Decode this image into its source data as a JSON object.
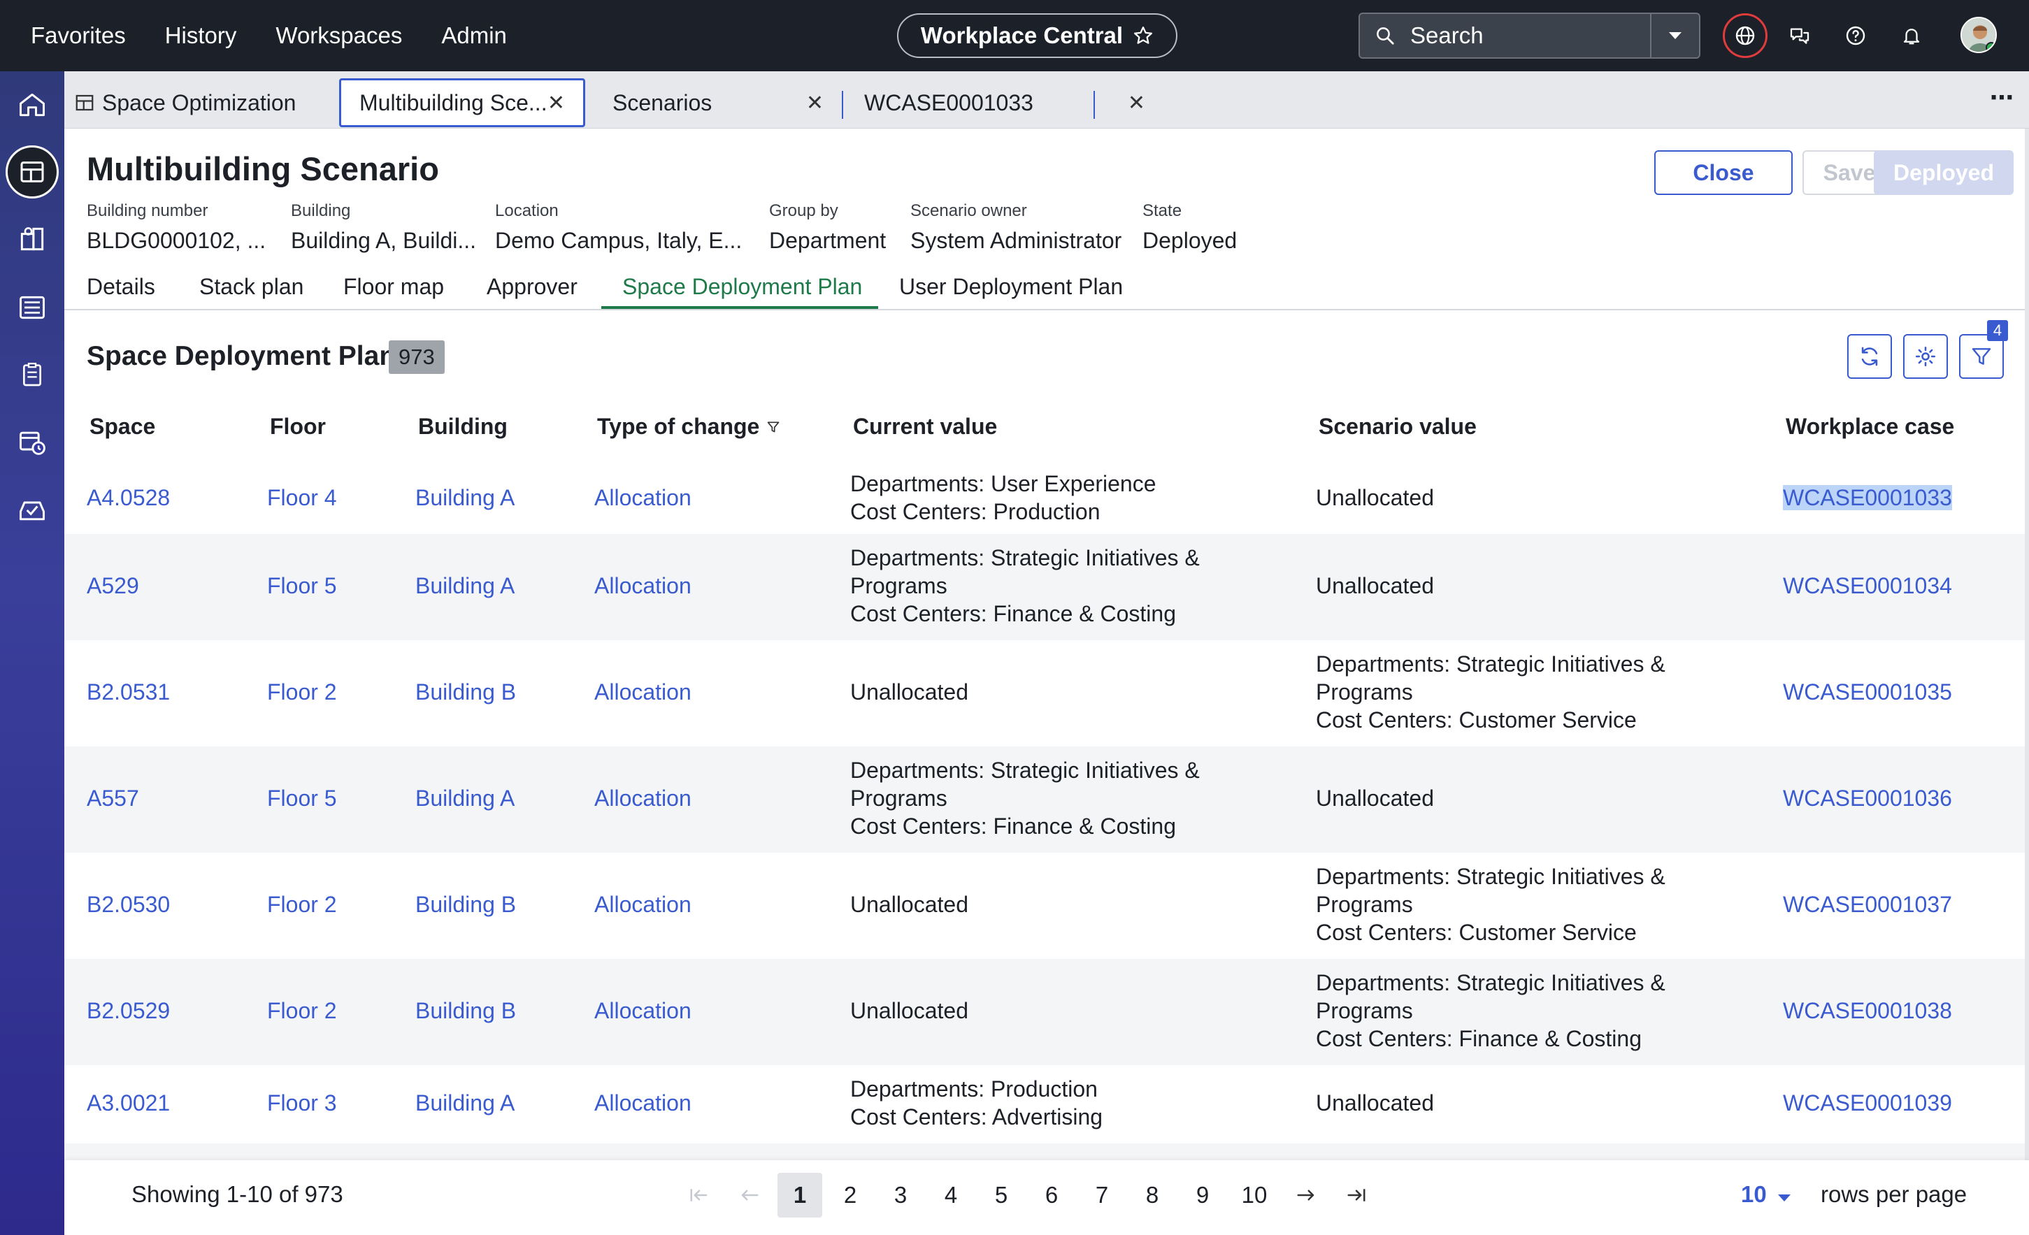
{
  "topbar": {
    "nav": [
      "Favorites",
      "History",
      "Workspaces",
      "Admin"
    ],
    "app_title": "Workplace Central",
    "search_placeholder": "Search"
  },
  "window_tabs": [
    {
      "label": "Space Optimization"
    },
    {
      "label": "Multibuilding Sce..."
    },
    {
      "label": "Scenarios"
    },
    {
      "label": "WCASE0001033"
    }
  ],
  "header": {
    "title": "Multibuilding Scenario",
    "close_label": "Close",
    "save_label": "Save",
    "deployed_label": "Deployed",
    "meta": [
      {
        "label": "Building number",
        "value": "BLDG0000102, ..."
      },
      {
        "label": "Building",
        "value": "Building A, Buildi..."
      },
      {
        "label": "Location",
        "value": "Demo Campus, Italy, E..."
      },
      {
        "label": "Group by",
        "value": "Department"
      },
      {
        "label": "Scenario owner",
        "value": "System Administrator"
      },
      {
        "label": "State",
        "value": "Deployed"
      }
    ]
  },
  "record_tabs": [
    "Details",
    "Stack plan",
    "Floor map",
    "Approver",
    "Space Deployment Plan",
    "User Deployment Plan"
  ],
  "section": {
    "title": "Space Deployment Plan",
    "count": "973",
    "filter_badge": "4"
  },
  "table": {
    "headers": [
      "Space",
      "Floor",
      "Building",
      "Type of change",
      "Current value",
      "Scenario value",
      "Workplace case"
    ],
    "rows": [
      {
        "space": "A4.0528",
        "floor": "Floor 4",
        "building": "Building A",
        "type": "Allocation",
        "current": [
          "Departments: User Experience",
          "Cost Centers: Production"
        ],
        "scenario": [
          "Unallocated"
        ],
        "case": "WCASE0001033"
      },
      {
        "space": "A529",
        "floor": "Floor 5",
        "building": "Building A",
        "type": "Allocation",
        "current": [
          "Departments: Strategic Initiatives &",
          "Programs",
          "Cost Centers: Finance & Costing"
        ],
        "scenario": [
          "Unallocated"
        ],
        "case": "WCASE0001034"
      },
      {
        "space": "B2.0531",
        "floor": "Floor 2",
        "building": "Building B",
        "type": "Allocation",
        "current": [
          "Unallocated"
        ],
        "scenario": [
          "Departments: Strategic Initiatives &",
          "Programs",
          "Cost Centers: Customer Service"
        ],
        "case": "WCASE0001035"
      },
      {
        "space": "A557",
        "floor": "Floor 5",
        "building": "Building A",
        "type": "Allocation",
        "current": [
          "Departments: Strategic Initiatives &",
          "Programs",
          "Cost Centers: Finance & Costing"
        ],
        "scenario": [
          "Unallocated"
        ],
        "case": "WCASE0001036"
      },
      {
        "space": "B2.0530",
        "floor": "Floor 2",
        "building": "Building B",
        "type": "Allocation",
        "current": [
          "Unallocated"
        ],
        "scenario": [
          "Departments: Strategic Initiatives &",
          "Programs",
          "Cost Centers: Customer Service"
        ],
        "case": "WCASE0001037"
      },
      {
        "space": "B2.0529",
        "floor": "Floor 2",
        "building": "Building B",
        "type": "Allocation",
        "current": [
          "Unallocated"
        ],
        "scenario": [
          "Departments: Strategic Initiatives &",
          "Programs",
          "Cost Centers: Finance & Costing"
        ],
        "case": "WCASE0001038"
      },
      {
        "space": "A3.0021",
        "floor": "Floor 3",
        "building": "Building A",
        "type": "Allocation",
        "current": [
          "Departments: Production",
          "Cost Centers: Advertising"
        ],
        "scenario": [
          "Unallocated"
        ],
        "case": "WCASE0001039"
      }
    ]
  },
  "footer": {
    "showing": "Showing 1-10 of 973",
    "pages": [
      "1",
      "2",
      "3",
      "4",
      "5",
      "6",
      "7",
      "8",
      "9",
      "10"
    ],
    "current_page": "1",
    "rows_per_page_value": "10",
    "rows_per_page_label": "rows per page"
  },
  "colors": {
    "topbar": "#1b2029",
    "link": "#3a5bd0",
    "active_tab": "#1f7a4a",
    "rail": "#33399a"
  }
}
